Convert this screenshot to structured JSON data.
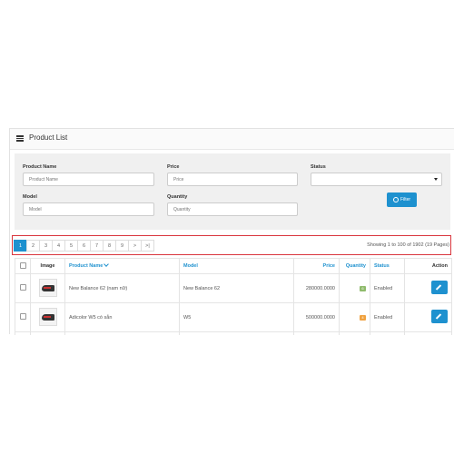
{
  "panel": {
    "title": "Product List",
    "icon": "list-icon"
  },
  "filter": {
    "product_name": {
      "label": "Product Name",
      "placeholder": "Product Name"
    },
    "price": {
      "label": "Price",
      "placeholder": "Price"
    },
    "status": {
      "label": "Status",
      "value": ""
    },
    "model": {
      "label": "Model",
      "placeholder": "Model"
    },
    "quantity": {
      "label": "Quantity",
      "placeholder": "Quantity"
    },
    "button_label": "Filter"
  },
  "pagination": {
    "pages": [
      "1",
      "2",
      "3",
      "4",
      "5",
      "6",
      "7",
      "8",
      "9",
      ">",
      ">|"
    ],
    "active_page": "1",
    "showing": "Showing 1 to 100 of 1902 (19 Pages)"
  },
  "table": {
    "headers": {
      "image": "Image",
      "product_name": "Product Name",
      "model": "Model",
      "price": "Price",
      "quantity": "Quantity",
      "status": "Status",
      "action": "Action"
    },
    "rows": [
      {
        "name": "New Balance 62 (nam nữ)",
        "model": "New Balance 62",
        "price": "280000.0000",
        "quantity": "6",
        "quantity_color": "#8fbb6c",
        "status": "Enabled"
      },
      {
        "name": "Adicolor W5 có sẵn",
        "model": "W5",
        "price": "500000.0000",
        "quantity": "4",
        "quantity_color": "#f0a240",
        "status": "Enabled"
      }
    ]
  },
  "colors": {
    "primary": "#1e91cf",
    "highlight_border": "#d9363e"
  }
}
